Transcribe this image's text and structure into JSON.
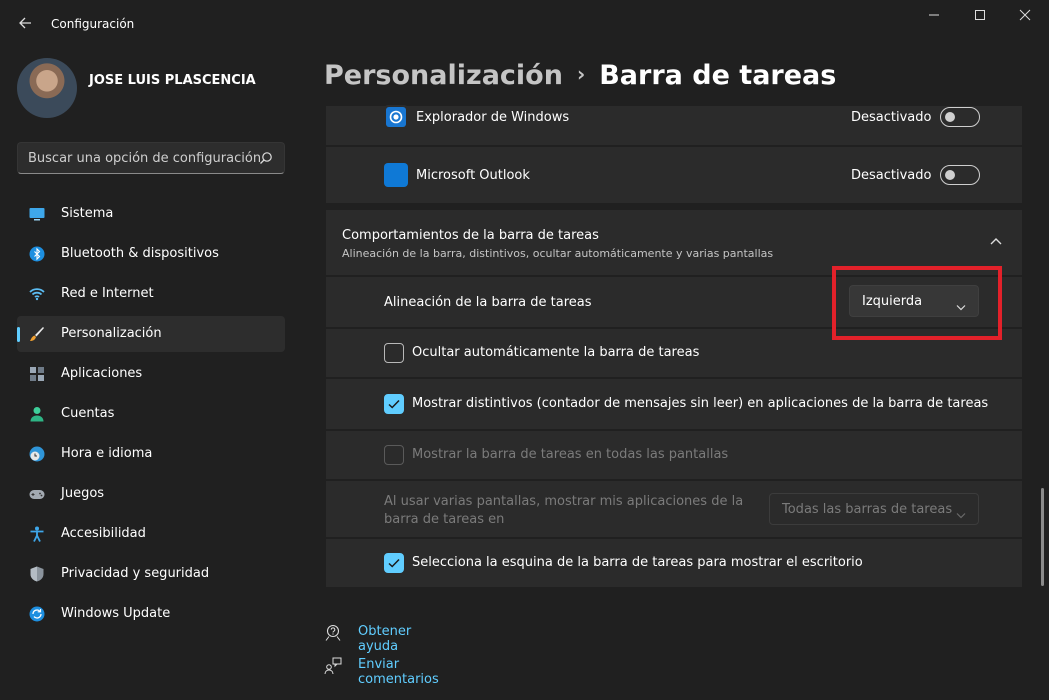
{
  "window": {
    "title": "Configuración"
  },
  "user": {
    "name": "JOSE LUIS PLASCENCIA"
  },
  "search": {
    "placeholder": "Buscar una opción de configuración"
  },
  "sidebar": {
    "items": [
      {
        "label": "Sistema",
        "icon": "monitor-icon"
      },
      {
        "label": "Bluetooth & dispositivos",
        "icon": "bluetooth-icon"
      },
      {
        "label": "Red e Internet",
        "icon": "wifi-icon"
      },
      {
        "label": "Personalización",
        "icon": "brush-icon",
        "active": true
      },
      {
        "label": "Aplicaciones",
        "icon": "apps-icon"
      },
      {
        "label": "Cuentas",
        "icon": "person-icon"
      },
      {
        "label": "Hora e idioma",
        "icon": "clock-globe-icon"
      },
      {
        "label": "Juegos",
        "icon": "gamepad-icon"
      },
      {
        "label": "Accesibilidad",
        "icon": "accessibility-icon"
      },
      {
        "label": "Privacidad y seguridad",
        "icon": "shield-icon"
      },
      {
        "label": "Windows Update",
        "icon": "update-icon"
      }
    ]
  },
  "header": {
    "parent": "Personalización",
    "separator": "›",
    "current": "Barra de tareas"
  },
  "overflow_apps": [
    {
      "label": "Explorador de Windows",
      "status": "Desactivado"
    },
    {
      "label": "Microsoft Outlook",
      "status": "Desactivado"
    }
  ],
  "behaviors": {
    "title": "Comportamientos de la barra de tareas",
    "subtitle": "Alineación de la barra, distintivos, ocultar automáticamente y varias pantallas",
    "alignment_label": "Alineación de la barra de tareas",
    "alignment_value": "Izquierda",
    "autohide_label": "Ocultar automáticamente la barra de tareas",
    "badges_label": "Mostrar distintivos (contador de mensajes sin leer) en aplicaciones de la barra de tareas",
    "all_displays_label": "Mostrar la barra de tareas en todas las pantallas",
    "multi_display_label_line1": "Al usar varias pantallas, mostrar mis aplicaciones de la",
    "multi_display_label_line2": "barra de tareas en",
    "multi_display_value": "Todas las barras de tareas",
    "corner_label": "Selecciona la esquina de la barra de tareas para mostrar el escritorio"
  },
  "links": {
    "help": "Obtener ayuda",
    "feedback": "Enviar comentarios"
  },
  "colors": {
    "accent": "#60cdff",
    "highlight": "#e3212a",
    "background": "#202020",
    "card": "#2b2b2b"
  }
}
